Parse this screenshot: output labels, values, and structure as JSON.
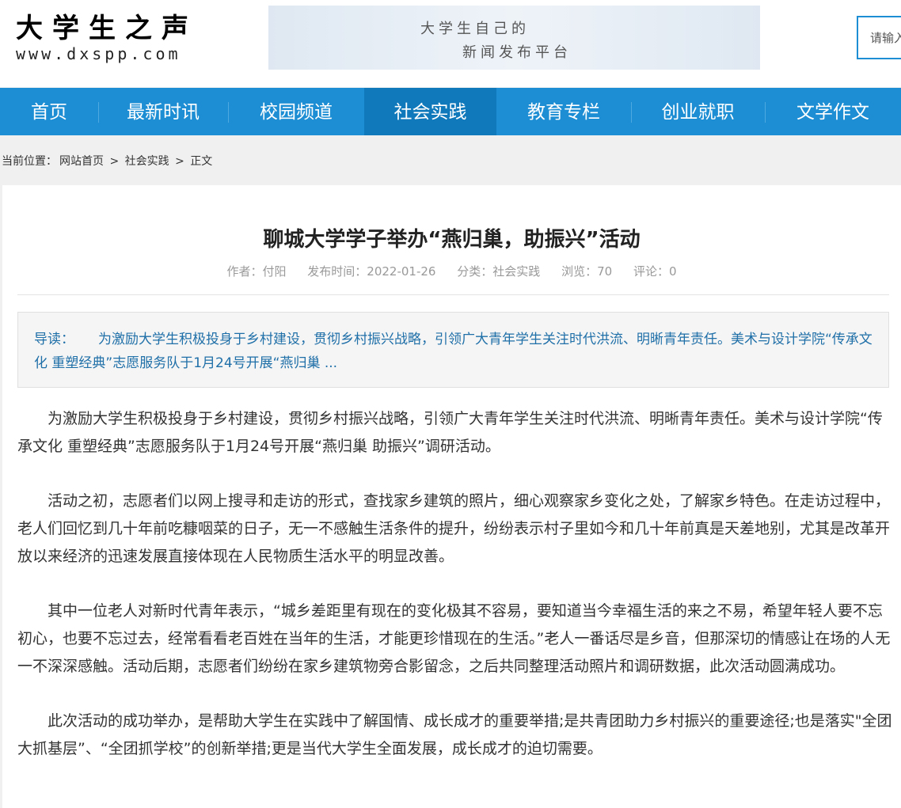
{
  "header": {
    "logo_title": "大学生之声",
    "logo_url": "www.dxspp.com",
    "banner_line1": "大学生自己的",
    "banner_line2": "新闻发布平台",
    "search_placeholder": "请输入"
  },
  "nav": {
    "items": [
      {
        "label": "首页"
      },
      {
        "label": "最新时讯"
      },
      {
        "label": "校园频道"
      },
      {
        "label": "社会实践"
      },
      {
        "label": "教育专栏"
      },
      {
        "label": "创业就职"
      },
      {
        "label": "文学作文"
      }
    ],
    "active_index": 3
  },
  "breadcrumb": {
    "prefix": "当前位置：",
    "home": "网站首页",
    "sep": ">",
    "category": "社会实践",
    "current": "正文"
  },
  "article": {
    "title": "聊城大学学子举办“燕归巢，助振兴”活动",
    "meta": {
      "author": "作者：付阳",
      "published": "发布时间：2022-01-26",
      "category": "分类：社会实践",
      "views": "浏览：70",
      "comments": "评论：0"
    },
    "summary_label": "导读：",
    "summary_text": "为激励大学生积极投身于乡村建设，贯彻乡村振兴战略，引领广大青年学生关注时代洪流、明晰青年责任。美术与设计学院“传承文化 重塑经典”志愿服务队于1月24号开展“燕归巢 ...",
    "paragraphs": [
      "为激励大学生积极投身于乡村建设，贯彻乡村振兴战略，引领广大青年学生关注时代洪流、明晰青年责任。美术与设计学院“传承文化 重塑经典”志愿服务队于1月24号开展“燕归巢 助振兴”调研活动。",
      "活动之初，志愿者们以网上搜寻和走访的形式，查找家乡建筑的照片，细心观察家乡变化之处，了解家乡特色。在走访过程中，老人们回忆到几十年前吃糠咽菜的日子，无一不感触生活条件的提升，纷纷表示村子里如今和几十年前真是天差地别，尤其是改革开放以来经济的迅速发展直接体现在人民物质生活水平的明显改善。",
      "其中一位老人对新时代青年表示，“城乡差距里有现在的变化极其不容易，要知道当今幸福生活的来之不易，希望年轻人要不忘初心，也要不忘过去，经常看看老百姓在当年的生活，才能更珍惜现在的生活。”老人一番话尽是乡音，但那深切的情感让在场的人无一不深深感触。活动后期，志愿者们纷纷在家乡建筑物旁合影留念，之后共同整理活动照片和调研数据，此次活动圆满成功。",
      "此次活动的成功举办，是帮助大学生在实践中了解国情、成长成才的重要举措;是共青团助力乡村振兴的重要途径;也是落实\"全团大抓基层”、“全团抓学校”的创新举措;更是当代大学生全面发展，成长成才的迫切需要。"
    ]
  },
  "colors": {
    "nav_bg": "#1d8ed3",
    "nav_active": "#0f79bb",
    "summary_text": "#1f6fa8"
  }
}
